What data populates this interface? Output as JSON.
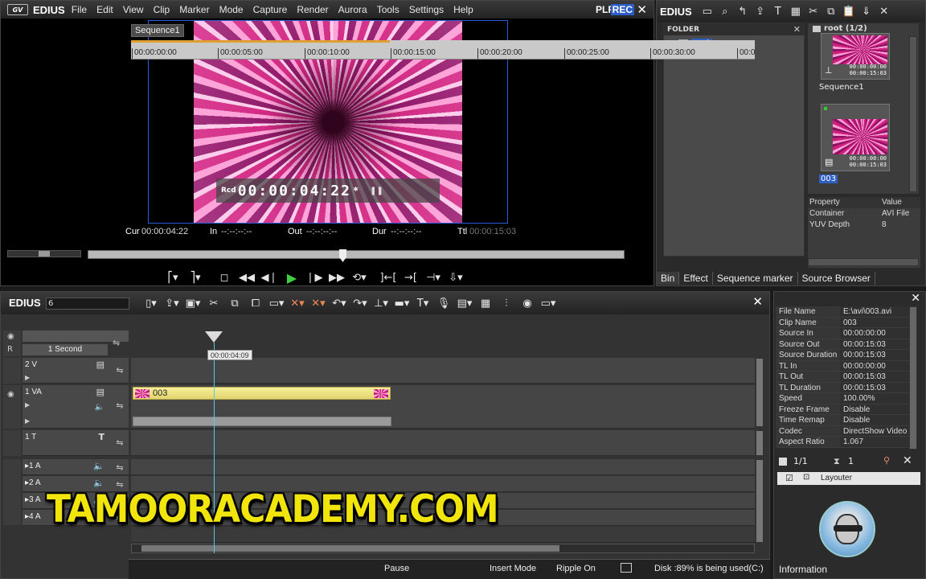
{
  "player": {
    "app_name": "EDIUS",
    "logo_badge": "GV",
    "menu": [
      "File",
      "Edit",
      "View",
      "Clip",
      "Marker",
      "Mode",
      "Capture",
      "Render",
      "Aurora",
      "Tools",
      "Settings",
      "Help"
    ],
    "plr_label": "PLR",
    "rec_label": "REC",
    "overlay": {
      "rcd_label": "Rcd",
      "timecode": "00:00:04:22",
      "marker": "*",
      "state_icon": "pause-icon"
    },
    "readout": {
      "cur_label": "Cur",
      "cur": "00:00:04:22",
      "in_label": "In",
      "in": "--:--:--:--",
      "out_label": "Out",
      "out": "--:--:--:--",
      "dur_label": "Dur",
      "dur": "--:--:--:--",
      "ttl_label": "Ttl",
      "ttl": "00:00:15:03"
    }
  },
  "bin": {
    "app_name": "EDIUS",
    "folder_header": "FOLDER",
    "folder_root": "root",
    "clips_header": "root (1/2)",
    "clips": [
      {
        "name": "Sequence1",
        "tc_in": "00:00:00:00",
        "tc_dur": "00:00:15:03",
        "selected": false
      },
      {
        "name": "003",
        "tc_in": "00:00:00:00",
        "tc_dur": "00:00:15:03",
        "selected": true
      }
    ],
    "property_header": {
      "k": "Property",
      "v": "Value"
    },
    "properties": [
      {
        "k": "Container",
        "v": "AVI File"
      },
      {
        "k": "YUV Depth",
        "v": "8"
      }
    ],
    "tabs": [
      "Bin",
      "Effect",
      "Sequence marker",
      "Source Browser"
    ]
  },
  "timeline": {
    "app_name": "EDIUS",
    "project_field": "6",
    "sequence_tab": "Sequence1",
    "scale": "1 Second",
    "ruler_ticks": [
      "00:00:00:00",
      "00:00:05:00",
      "00:00:10:00",
      "00:00:15:00",
      "00:00:20:00",
      "00:00:25:00",
      "00:00:30:00",
      "00:0"
    ],
    "cursor_tip": "00:00:04:09",
    "tracks": {
      "v2": "2 V",
      "va1": "1 VA",
      "t1": "1 T",
      "a1": "1 A",
      "a2": "2 A",
      "a3": "3 A",
      "a4": "4 A"
    },
    "clip_name": "003",
    "status": {
      "state": "Pause",
      "mode": "Insert Mode",
      "ripple": "Ripple On",
      "disk": "Disk :89% is being used(C:)"
    }
  },
  "watermark": "TAMOORACADEMY.COM",
  "info": {
    "rows": [
      {
        "k": "File Name",
        "v": "E:\\avi\\003.avi"
      },
      {
        "k": "Clip Name",
        "v": "003"
      },
      {
        "k": "Source In",
        "v": "00:00:00:00"
      },
      {
        "k": "Source Out",
        "v": "00:00:15:03"
      },
      {
        "k": "Source Duration",
        "v": "00:00:15:03"
      },
      {
        "k": "TL In",
        "v": "00:00:00:00"
      },
      {
        "k": "TL Out",
        "v": "00:00:15:03"
      },
      {
        "k": "TL Duration",
        "v": "00:00:15:03"
      },
      {
        "k": "Speed",
        "v": "100.00%"
      },
      {
        "k": "Freeze Frame",
        "v": "Disable"
      },
      {
        "k": "Time Remap",
        "v": "Disable"
      },
      {
        "k": "Codec",
        "v": "DirectShow Video"
      },
      {
        "k": "Aspect Ratio",
        "v": "1.067"
      }
    ],
    "page": "1/1",
    "count": "1",
    "layouter": "Layouter",
    "tab": "Information"
  }
}
